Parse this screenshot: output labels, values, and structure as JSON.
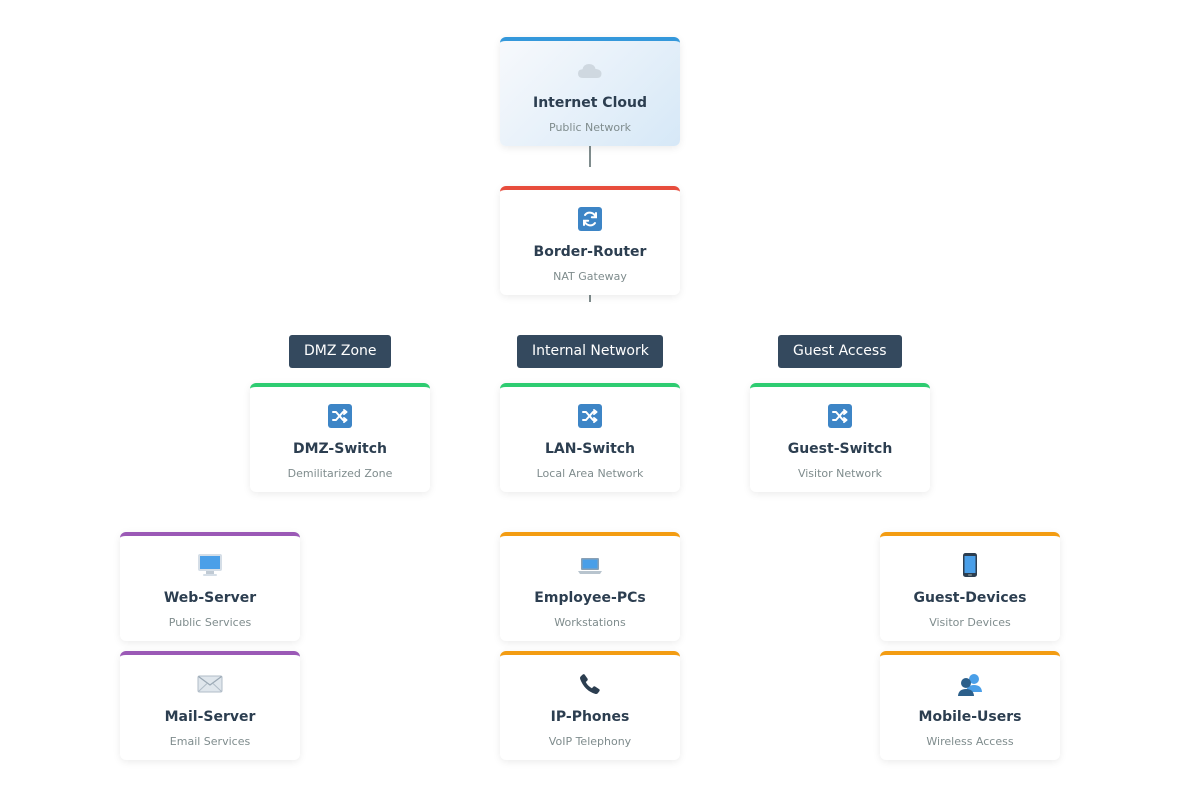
{
  "colors": {
    "internet": "#3498db",
    "router": "#e74c3c",
    "switch": "#2ecc71",
    "server": "#9b59b6",
    "endpoint": "#f39c12",
    "zone_label_bg": "#34495e"
  },
  "nodes": {
    "internet": {
      "title": "Internet Cloud",
      "subtitle": "Public Network",
      "icon": "cloud-icon"
    },
    "router": {
      "title": "Border-Router",
      "subtitle": "NAT Gateway",
      "icon": "refresh-icon"
    },
    "dmz_switch": {
      "title": "DMZ-Switch",
      "subtitle": "Demilitarized Zone",
      "icon": "shuffle-icon"
    },
    "lan_switch": {
      "title": "LAN-Switch",
      "subtitle": "Local Area Network",
      "icon": "shuffle-icon"
    },
    "guest_switch": {
      "title": "Guest-Switch",
      "subtitle": "Visitor Network",
      "icon": "shuffle-icon"
    },
    "web_server": {
      "title": "Web-Server",
      "subtitle": "Public Services",
      "icon": "monitor-icon"
    },
    "mail_server": {
      "title": "Mail-Server",
      "subtitle": "Email Services",
      "icon": "email-icon"
    },
    "employee_pcs": {
      "title": "Employee-PCs",
      "subtitle": "Workstations",
      "icon": "laptop-icon"
    },
    "ip_phones": {
      "title": "IP-Phones",
      "subtitle": "VoIP Telephony",
      "icon": "phone-icon"
    },
    "guest_devices": {
      "title": "Guest-Devices",
      "subtitle": "Visitor Devices",
      "icon": "mobile-phone-icon"
    },
    "mobile_users": {
      "title": "Mobile-Users",
      "subtitle": "Wireless Access",
      "icon": "users-icon"
    }
  },
  "zones": {
    "dmz": "DMZ Zone",
    "internal": "Internal Network",
    "guest": "Guest Access"
  }
}
